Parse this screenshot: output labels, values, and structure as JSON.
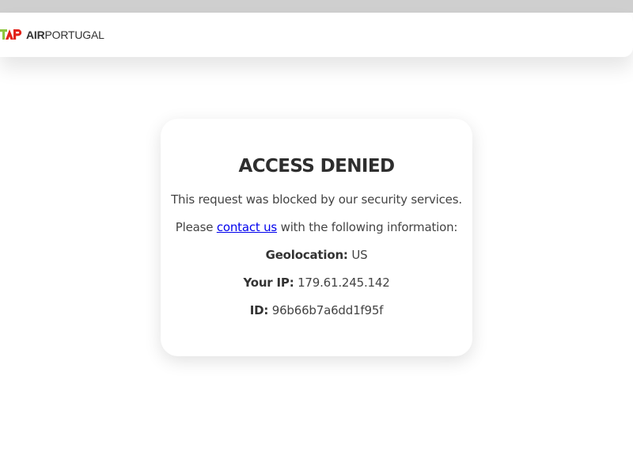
{
  "logo": {
    "brand": "TAP",
    "air": "AIR",
    "portugal": "PORTUGAL",
    "colors": {
      "green": "#8dc63f",
      "red": "#e2231a",
      "text": "#333333"
    }
  },
  "card": {
    "title": "ACCESS DENIED",
    "message": "This request was blocked by our security services.",
    "please_prefix": "Please",
    "contact_link": "contact us",
    "please_suffix": "with the following information:",
    "geolocation_label": "Geolocation:",
    "geolocation_value": "US",
    "ip_label": "Your IP:",
    "ip_value": "179.61.245.142",
    "id_label": "ID:",
    "id_value": "96b66b7a6dd1f95f"
  }
}
